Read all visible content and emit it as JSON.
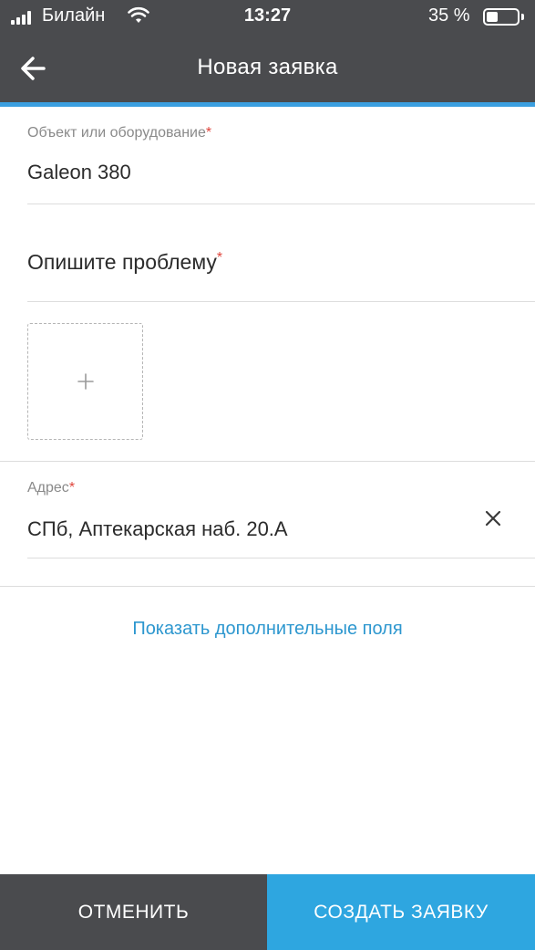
{
  "status_bar": {
    "carrier": "Билайн",
    "time": "13:27",
    "battery": "35 %"
  },
  "header": {
    "title": "Новая заявка",
    "back_icon": "arrow-left-icon"
  },
  "form": {
    "object": {
      "label": "Объект или оборудование",
      "required_mark": "*",
      "value": "Galeon 380"
    },
    "problem": {
      "placeholder": "Опишите проблему",
      "required_mark": "*"
    },
    "photo": {
      "add_symbol": "+"
    },
    "address": {
      "label": "Адрес",
      "required_mark": "*",
      "value": "СПб, Аптекарская наб. 20.А",
      "clear_icon": "close-icon"
    },
    "more_fields_link": "Показать дополнительные поля"
  },
  "actions": {
    "cancel_label": "ОТМЕНИТЬ",
    "create_label": "СОЗДАТЬ ЗАЯВКУ"
  },
  "colors": {
    "header_bg": "#4a4b4e",
    "accent": "#3b9fe0",
    "link": "#2d97cf",
    "required": "#e0453c",
    "primary_button": "#2ea6e0"
  }
}
